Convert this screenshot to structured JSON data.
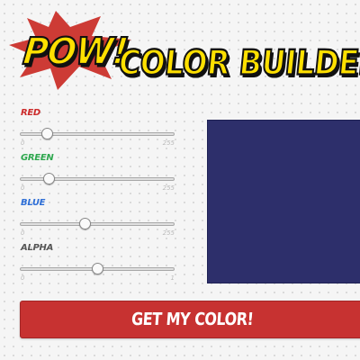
{
  "header": {
    "pow_text": "POW!",
    "title": "COLOR BUILDER!"
  },
  "colors": {
    "burst": "#cd3b35",
    "title_fill": "#ffe000",
    "preview": "#2d2f6b",
    "button": "#c73231"
  },
  "sliders": [
    {
      "label": "RED",
      "label_color": "#cc2b2b",
      "min": "0",
      "max": "255",
      "value": 45
    },
    {
      "label": "GREEN",
      "label_color": "#2fa84f",
      "min": "0",
      "max": "255",
      "value": 47
    },
    {
      "label": "BLUE",
      "label_color": "#2f6fd6",
      "min": "0",
      "max": "255",
      "value": 107
    },
    {
      "label": "ALPHA",
      "label_color": "#555555",
      "min": "0",
      "max": "1",
      "value": 0.5
    }
  ],
  "button": {
    "label": "GET MY COLOR!"
  }
}
